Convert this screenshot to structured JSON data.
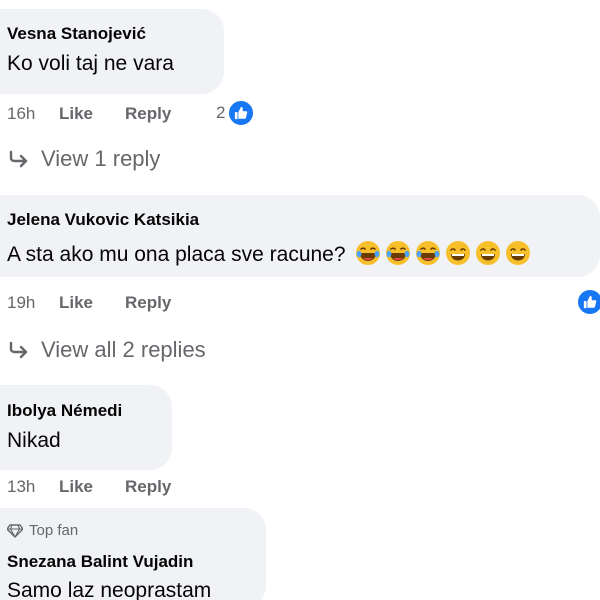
{
  "comments": [
    {
      "author": "Vesna Stanojević",
      "text": "Ko voli taj ne vara",
      "time": "16h",
      "like_label": "Like",
      "reply_label": "Reply",
      "reaction_count": "2",
      "reaction_icon": "thumbs-up-icon",
      "view_replies": "View 1 reply"
    },
    {
      "author": "Jelena Vukovic Katsikia",
      "text": "A sta ako mu ona placa sve racune?",
      "emojis": [
        "laughing-crying-emoji",
        "laughing-crying-emoji",
        "laughing-crying-emoji",
        "grinning-emoji",
        "grinning-emoji",
        "grinning-emoji"
      ],
      "time": "19h",
      "like_label": "Like",
      "reply_label": "Reply",
      "reaction_icon": "thumbs-up-icon",
      "view_replies": "View all 2 replies"
    },
    {
      "author": "Ibolya Némedi",
      "text": "Nikad",
      "time": "13h",
      "like_label": "Like",
      "reply_label": "Reply"
    },
    {
      "badge": "Top fan",
      "badge_icon": "diamond-icon",
      "author": "Snezana Balint Vujadin",
      "text": "Samo laz neoprastam"
    }
  ],
  "colors": {
    "bubble": "#f0f2f5",
    "secondary_text": "#65676b",
    "like_blue": "#1877f2"
  }
}
